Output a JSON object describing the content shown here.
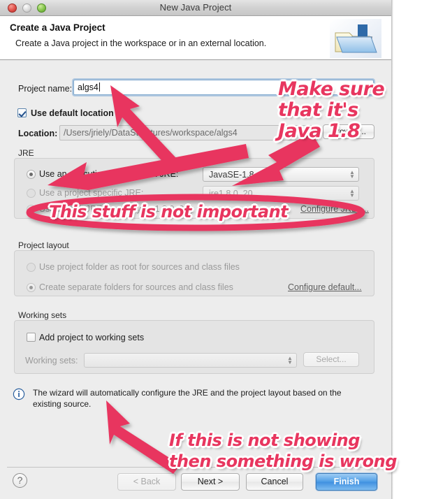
{
  "window": {
    "title": "New Java Project",
    "traffic_lights": [
      "close-button",
      "minimize-button",
      "zoom-button"
    ]
  },
  "banner": {
    "title": "Create a Java Project",
    "subtitle": "Create a Java project in the workspace or in an external location.",
    "icon": "java-project-folder-icon"
  },
  "form": {
    "project_name_label": "Project name:",
    "project_name_value": "algs4",
    "use_default_location_label": "Use default location",
    "use_default_location_checked": true,
    "location_label": "Location:",
    "location_value": "/Users/jriely/DataStructures/workspace/algs4",
    "browse_label": "Browse..."
  },
  "jre": {
    "group_label": "JRE",
    "option_execution_env": "Use an execution environment JRE:",
    "option_project_specific": "Use a project specific JRE:",
    "option_default": "Use default JRE (currently 'jre1.8.0_20')",
    "execution_env_value": "JavaSE-1.8",
    "project_specific_value": "jre1.8.0_20",
    "configure_link": "Configure JREs..."
  },
  "project_layout": {
    "group_label": "Project layout",
    "option_project_folder": "Use project folder as root for sources and class files",
    "option_separate_folders": "Create separate folders for sources and class files",
    "configure_link": "Configure default..."
  },
  "working_sets": {
    "group_label": "Working sets",
    "add_checkbox_label": "Add project to working sets",
    "working_sets_label": "Working sets:",
    "working_sets_value": "",
    "select_label": "Select..."
  },
  "status": {
    "icon": "info-icon",
    "message": "The wizard will automatically configure the JRE and the project layout based on the existing source."
  },
  "footer": {
    "help_label": "?",
    "back_label": "< Back",
    "next_label": "Next >",
    "cancel_label": "Cancel",
    "finish_label": "Finish"
  },
  "annotations": {
    "color": "#e8365f",
    "note_java18_line1": "Make sure",
    "note_java18_line2": "that it's",
    "note_java18_line3": "Java 1.8",
    "note_not_important": "This stuff is not important",
    "note_showing_line1": "If this is not showing",
    "note_showing_line2": "then something is wrong"
  }
}
